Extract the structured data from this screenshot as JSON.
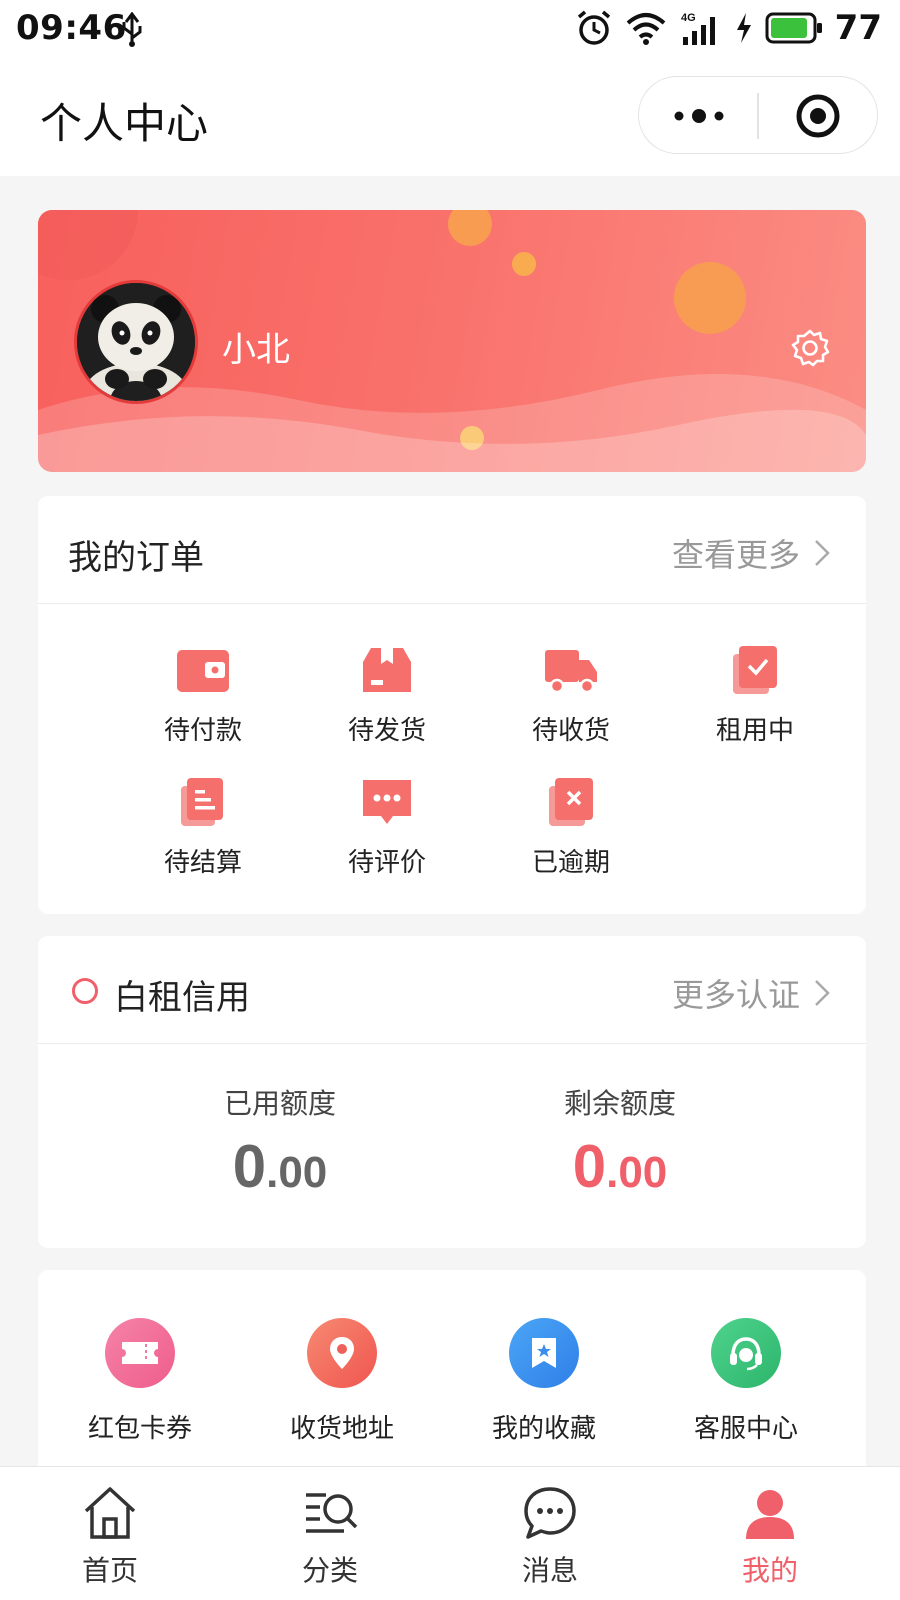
{
  "status_bar": {
    "time": "09:46",
    "network": "4G",
    "battery": "77",
    "battery_color": "#3cc13c"
  },
  "header": {
    "title": "个人中心"
  },
  "profile": {
    "username": "小北",
    "banner_colors": [
      "#f8605d",
      "#fb8d84"
    ]
  },
  "orders": {
    "title": "我的订单",
    "more_label": "查看更多",
    "items": [
      {
        "label": "待付款",
        "icon": "wallet-icon"
      },
      {
        "label": "待发货",
        "icon": "package-icon"
      },
      {
        "label": "待收货",
        "icon": "truck-icon"
      },
      {
        "label": "租用中",
        "icon": "checked-clipboard-icon"
      },
      {
        "label": "待结算",
        "icon": "document-icon"
      },
      {
        "label": "待评价",
        "icon": "comment-icon"
      },
      {
        "label": "已逾期",
        "icon": "overdue-icon"
      }
    ]
  },
  "credit": {
    "title": "白租信用",
    "more_label": "更多认证",
    "used": {
      "label": "已用额度",
      "int": "0",
      "dec": ".00",
      "color": "#666666"
    },
    "remaining": {
      "label": "剩余额度",
      "int": "0",
      "dec": ".00",
      "color": "#f0606a"
    }
  },
  "services": [
    {
      "label": "红包卡券",
      "icon": "coupon-icon",
      "color": "#f2689a"
    },
    {
      "label": "收货地址",
      "icon": "location-icon",
      "color": "#f3665f"
    },
    {
      "label": "我的收藏",
      "icon": "bookmark-icon",
      "color": "#3b8ef0"
    },
    {
      "label": "客服中心",
      "icon": "headset-icon",
      "color": "#36c37b"
    }
  ],
  "tabbar": {
    "active_color": "#f0606a",
    "items": [
      {
        "label": "首页",
        "icon": "home-icon"
      },
      {
        "label": "分类",
        "icon": "category-icon"
      },
      {
        "label": "消息",
        "icon": "message-icon"
      },
      {
        "label": "我的",
        "icon": "user-icon"
      }
    ]
  }
}
